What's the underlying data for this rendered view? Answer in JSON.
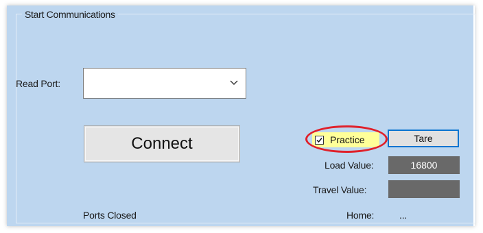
{
  "group": {
    "title": "Start Communications"
  },
  "read_port": {
    "label": "Read Port:",
    "value": ""
  },
  "connect_button": {
    "label": "Connect"
  },
  "practice": {
    "label": "Practice",
    "checked": true
  },
  "tare_button": {
    "label": "Tare"
  },
  "load": {
    "label": "Load Value:",
    "value": "16800"
  },
  "travel": {
    "label": "Travel Value:",
    "value": ""
  },
  "status": {
    "ports": "Ports Closed"
  },
  "home": {
    "label": "Home:",
    "value": "..."
  },
  "colors": {
    "panel_bg": "#bdd6ef",
    "value_box_bg": "#696969",
    "practice_highlight": "#ffff99",
    "annotation_ring": "#e0202a",
    "tare_focus_border": "#0a74d0"
  },
  "icons": {
    "dropdown": "chevron-down-icon",
    "checkbox": "checkmark-icon"
  }
}
